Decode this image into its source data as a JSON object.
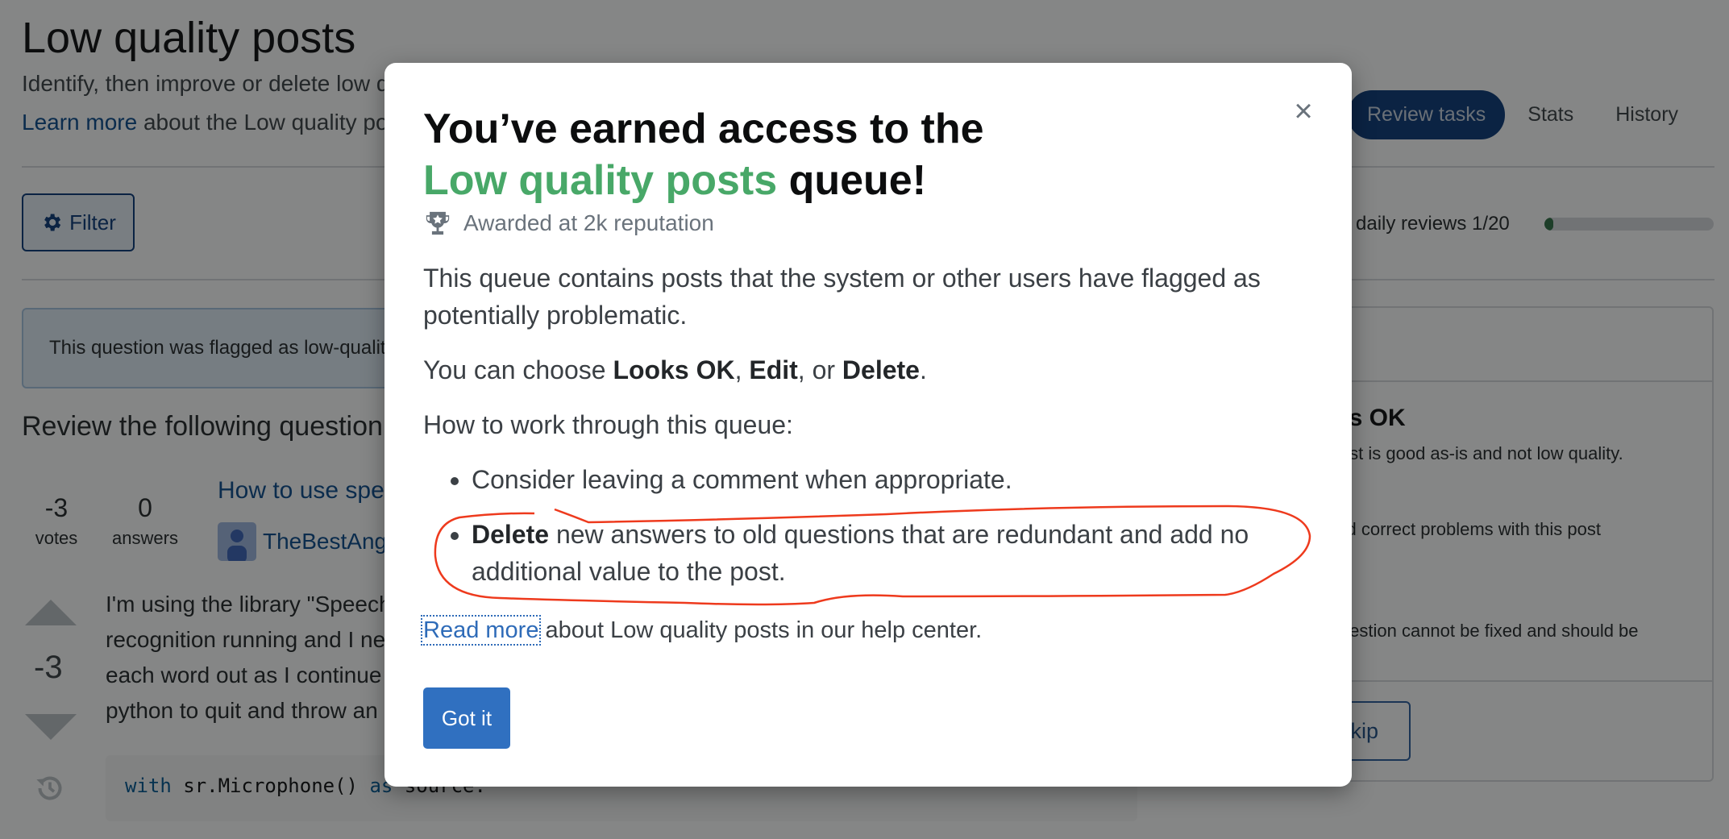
{
  "header": {
    "title": "Low quality posts",
    "description": "Identify, then improve or delete low quality posts.",
    "learn_more_link": "Learn more",
    "learn_more_suffix": " about the Low quality posts queue"
  },
  "tabs": [
    {
      "label": "Review tasks",
      "active": true
    },
    {
      "label": "Stats",
      "active": false
    },
    {
      "label": "History",
      "active": false
    }
  ],
  "toolbar": {
    "filter_label": "Filter",
    "daily_reviews_label": "daily reviews 1/20",
    "daily_reviews_done": 1,
    "daily_reviews_total": 20
  },
  "notice": {
    "text": "This question was flagged as low-quality"
  },
  "review": {
    "heading": "Review the following question",
    "votes": "-3",
    "votes_label": "votes",
    "answers": "0",
    "answers_label": "answers",
    "question_title": "How to use speech recognition",
    "author": "TheBestAngular",
    "score": "-3",
    "body_lines": [
      "I'm using the library \"SpeechRecognition\"",
      "recognition running and I need",
      "each word out as I continue",
      "python to quit and throw an"
    ],
    "code_kw1": "with",
    "code_mid": " sr.Microphone() ",
    "code_kw2": "as",
    "code_end": " source:"
  },
  "actions_panel": {
    "looks_ok_title": "Looks OK",
    "looks_ok_desc": "This post is good as-is and not low quality.",
    "edit_desc": "Edit and correct problems with this post",
    "delete_desc": "This question cannot be fixed and should be",
    "skip_label": "Skip"
  },
  "modal": {
    "title_line1": "You’ve earned access to the",
    "title_accent": "Low quality posts",
    "title_line2_suffix": " queue!",
    "awarded": "Awarded at 2k reputation",
    "intro": "This queue contains posts that the system or other users have flagged as potentially problematic.",
    "choose_prefix": "You can choose ",
    "choose_opt1": "Looks OK",
    "choose_sep1": ", ",
    "choose_opt2": "Edit",
    "choose_sep2": ", or ",
    "choose_opt3": "Delete",
    "choose_end": ".",
    "how_to": "How to work through this queue:",
    "bullet1": "Consider leaving a comment when appropriate.",
    "bullet2_bold": "Delete",
    "bullet2_rest": " new answers to old questions that are redundant and add no additional value to the post.",
    "read_more_link": "Read more",
    "read_more_suffix": " about Low quality posts in our help center.",
    "got_it_label": "Got it",
    "close_glyph": "×",
    "annotation_color": "#ee3a1d"
  }
}
